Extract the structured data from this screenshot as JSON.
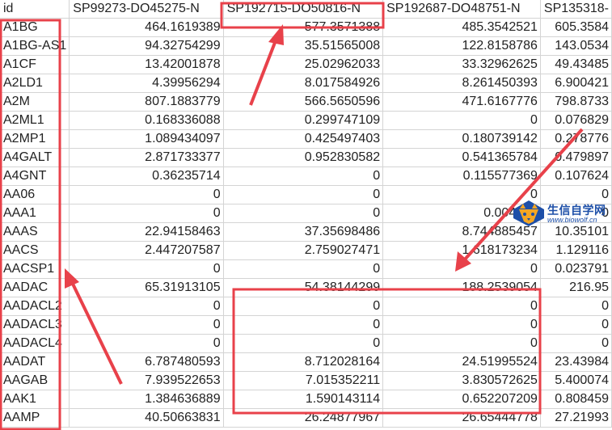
{
  "columns": [
    "id",
    "SP99273-DO45275-N",
    "SP192715-DO50816-N",
    "SP192687-DO48751-N",
    "SP135318-"
  ],
  "rows": [
    [
      "A1BG",
      "464.1619389",
      "577.3571388",
      "485.3542521",
      "605.3584"
    ],
    [
      "A1BG-AS1",
      "94.32754299",
      "35.51565008",
      "122.8158786",
      "143.0534"
    ],
    [
      "A1CF",
      "13.42001878",
      "25.02962033",
      "33.32962625",
      "49.43485"
    ],
    [
      "A2LD1",
      "4.39956294",
      "8.017584926",
      "8.261450393",
      "6.900421"
    ],
    [
      "A2M",
      "807.1883779",
      "566.5650596",
      "471.6167776",
      "798.8733"
    ],
    [
      "A2ML1",
      "0.168336088",
      "0.299747109",
      "0",
      "0.076829"
    ],
    [
      "A2MP1",
      "1.089434097",
      "0.425497403",
      "0.180739142",
      "0.278776"
    ],
    [
      "A4GALT",
      "2.871733377",
      "0.952830582",
      "0.541365784",
      "0.479897"
    ],
    [
      "A4GNT",
      "0.36235714",
      "0",
      "0.115577369",
      "0.107624"
    ],
    [
      "AA06",
      "0",
      "0",
      "0",
      "0"
    ],
    [
      "AAA1",
      "0",
      "0",
      "0.004932",
      "0"
    ],
    [
      "AAAS",
      "22.94158463",
      "37.35698486",
      "8.744885457",
      "10.35101"
    ],
    [
      "AACS",
      "2.447207587",
      "2.759027471",
      "1.618173234",
      "1.129116"
    ],
    [
      "AACSP1",
      "0",
      "0",
      "0",
      "0.023791"
    ],
    [
      "AADAC",
      "65.31913105",
      "54.38144299",
      "188.2539054",
      "216.95"
    ],
    [
      "AADACL2",
      "0",
      "0",
      "0",
      "0"
    ],
    [
      "AADACL3",
      "0",
      "0",
      "0",
      "0"
    ],
    [
      "AADACL4",
      "0",
      "0",
      "0",
      "0"
    ],
    [
      "AADAT",
      "6.787480593",
      "8.712028164",
      "24.51995524",
      "23.43984"
    ],
    [
      "AAGAB",
      "7.939522653",
      "7.015352211",
      "3.830572625",
      "5.400074"
    ],
    [
      "AAK1",
      "1.384636889",
      "1.590143114",
      "0.652207209",
      "0.808459"
    ],
    [
      "AAMP",
      "40.50663831",
      "26.24877967",
      "26.65444778",
      "27.21993"
    ]
  ],
  "watermark": {
    "name": "生信自学网",
    "url": "www.biowolf.cn"
  },
  "annotation_color": "#e8414a",
  "brand_color": "#1d4fa8"
}
